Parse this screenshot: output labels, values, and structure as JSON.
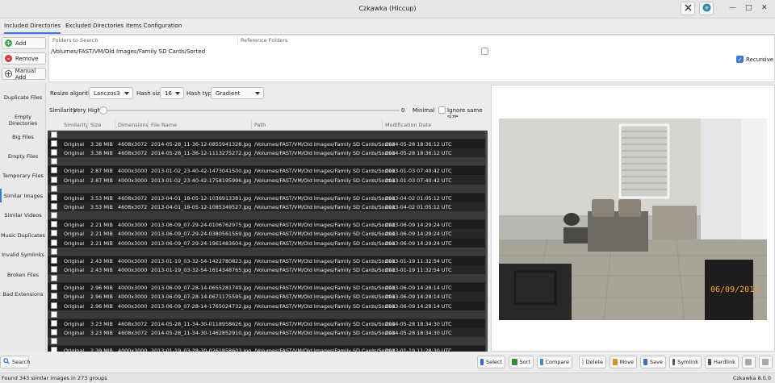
{
  "window": {
    "title": "Czkawka (Hiccup)"
  },
  "top_tabs": [
    "Included Directories",
    "Excluded Directories",
    "Items Configuration"
  ],
  "dir_buttons": {
    "add": "Add",
    "remove": "Remove",
    "manual_add": "Manual Add"
  },
  "dir_table": {
    "col_folders": "Folders to Search",
    "col_reference": "Reference Folders",
    "path": "/Volumes/FAST/VM/Old Images/Family SD Cards/Sorted",
    "recursive_label": "Recursive",
    "recursive_checked": true
  },
  "sidebar": [
    "Duplicate Files",
    "Empty Directories",
    "Big Files",
    "Empty Files",
    "Temporary Files",
    "Similar Images",
    "Similar Videos",
    "Music Duplicates",
    "Invalid Symlinks",
    "Broken Files",
    "Bad Extensions"
  ],
  "sidebar_active": "Similar Images",
  "options": {
    "resize_label": "Resize algorithm",
    "resize_value": "Lanczos3",
    "hash_size_label": "Hash size",
    "hash_size_value": "16",
    "hash_type_label": "Hash type",
    "hash_type_value": "Gradient",
    "similarity_label": "Similarity",
    "similarity_value": "Very High",
    "slider_value": "0",
    "minimal_label": "Minimal",
    "ignore_same_size_label": "Ignore same size"
  },
  "results": {
    "columns": [
      "Similarity",
      "Size",
      "Dimensions",
      "File Name",
      "Path",
      "Modification Date"
    ],
    "rows": [
      {
        "g": true
      },
      {
        "sim": "Original",
        "size": "3.38 MiB",
        "dim": "4608x3072",
        "name": "2014-05-28_11-36-12-0855941328.jpg",
        "path": "/Volumes/FAST/VM/Old Images/Family SD Cards/Sorted",
        "date": "2014-05-28 18:36:12 UTC"
      },
      {
        "sim": "Original",
        "size": "3.38 MiB",
        "dim": "4608x3072",
        "name": "2014-05-28_11-36-12-1113275272.jpg",
        "path": "/Volumes/FAST/VM/Old Images/Family SD Cards/Sorted",
        "date": "2014-05-28 18:36:12 UTC"
      },
      {
        "g": true
      },
      {
        "sim": "Original",
        "size": "2.87 MiB",
        "dim": "4000x3000",
        "name": "2013-01-02_23-40-42-1473041500.jpg",
        "path": "/Volumes/FAST/VM/Old Images/Family SD Cards/Sorted",
        "date": "2013-01-03 07:40:42 UTC"
      },
      {
        "sim": "Original",
        "size": "2.87 MiB",
        "dim": "4000x3000",
        "name": "2013-01-02_23-40-42-1758195996.jpg",
        "path": "/Volumes/FAST/VM/Old Images/Family SD Cards/Sorted",
        "date": "2013-01-03 07:40:42 UTC"
      },
      {
        "g": true
      },
      {
        "sim": "Original",
        "size": "3.53 MiB",
        "dim": "4608x3072",
        "name": "2013-04-01_18-05-12-1036913381.jpg",
        "path": "/Volumes/FAST/VM/Old Images/Family SD Cards/Sorted",
        "date": "2013-04-02 01:05:12 UTC"
      },
      {
        "sim": "Original",
        "size": "3.53 MiB",
        "dim": "4608x3072",
        "name": "2013-04-01_18-05-12-1085349527.jpg",
        "path": "/Volumes/FAST/VM/Old Images/Family SD Cards/Sorted",
        "date": "2013-04-02 01:05:12 UTC"
      },
      {
        "g": true
      },
      {
        "sim": "Original",
        "size": "2.21 MiB",
        "dim": "4000x3000",
        "name": "2013-06-09_07-29-24-0106762975.jpg",
        "path": "/Volumes/FAST/VM/Old Images/Family SD Cards/Sorted",
        "date": "2013-06-09 14:29:24 UTC"
      },
      {
        "sim": "Original",
        "size": "2.21 MiB",
        "dim": "4000x3000",
        "name": "2013-06-09_07-29-24-0380561559.jpg",
        "path": "/Volumes/FAST/VM/Old Images/Family SD Cards/Sorted",
        "date": "2013-06-09 14:29:24 UTC"
      },
      {
        "sim": "Original",
        "size": "2.21 MiB",
        "dim": "4000x3000",
        "name": "2013-06-09_07-29-24-1961483604.jpg",
        "path": "/Volumes/FAST/VM/Old Images/Family SD Cards/Sorted",
        "date": "2013-06-09 14:29:24 UTC"
      },
      {
        "g": true
      },
      {
        "sim": "Original",
        "size": "2.43 MiB",
        "dim": "4000x3000",
        "name": "2013-01-19_03-32-54-1422780823.jpg",
        "path": "/Volumes/FAST/VM/Old Images/Family SD Cards/Sorted",
        "date": "2013-01-19 11:32:54 UTC"
      },
      {
        "sim": "Original",
        "size": "2.43 MiB",
        "dim": "4000x3000",
        "name": "2013-01-19_03-32-54-1614348765.jpg",
        "path": "/Volumes/FAST/VM/Old Images/Family SD Cards/Sorted",
        "date": "2013-01-19 11:32:54 UTC"
      },
      {
        "g": true
      },
      {
        "sim": "Original",
        "size": "2.96 MiB",
        "dim": "4000x3000",
        "name": "2013-06-09_07-28-14-0655281749.jpg",
        "path": "/Volumes/FAST/VM/Old Images/Family SD Cards/Sorted",
        "date": "2013-06-09 14:28:14 UTC"
      },
      {
        "sim": "Original",
        "size": "2.96 MiB",
        "dim": "4000x3000",
        "name": "2013-06-09_07-28-14-0671175595.jpg",
        "path": "/Volumes/FAST/VM/Old Images/Family SD Cards/Sorted",
        "date": "2013-06-09 14:28:14 UTC"
      },
      {
        "sim": "Original",
        "size": "2.96 MiB",
        "dim": "4000x3000",
        "name": "2013-06-09_07-28-14-1765024732.jpg",
        "path": "/Volumes/FAST/VM/Old Images/Family SD Cards/Sorted",
        "date": "2013-06-09 14:28:14 UTC"
      },
      {
        "g": true
      },
      {
        "sim": "Original",
        "size": "3.23 MiB",
        "dim": "4608x3072",
        "name": "2014-05-28_11-34-30-0118958626.jpg",
        "path": "/Volumes/FAST/VM/Old Images/Family SD Cards/Sorted",
        "date": "2014-05-28 18:34:30 UTC"
      },
      {
        "sim": "Original",
        "size": "3.23 MiB",
        "dim": "4608x3072",
        "name": "2014-05-28_11-34-30-1462852910.jpg",
        "path": "/Volumes/FAST/VM/Old Images/Family SD Cards/Sorted",
        "date": "2014-05-28 18:34:30 UTC"
      },
      {
        "g": true
      },
      {
        "sim": "Original",
        "size": "2.39 MiB",
        "dim": "4000x3000",
        "name": "2013-01-19_03-28-30-0261858603.jpg",
        "path": "/Volumes/FAST/VM/Old Images/Family SD Cards/Sorted",
        "date": "2013-01-19 11:28:30 UTC"
      }
    ]
  },
  "preview": {
    "date_stamp": "06/09/2013"
  },
  "bottom": {
    "search": "Search",
    "select": "Select",
    "sort": "Sort",
    "compare": "Compare",
    "delete": "Delete",
    "move": "Move",
    "save": "Save",
    "symlink": "Symlink",
    "hardlink": "Hardlink"
  },
  "status": {
    "left": "Found 343 similar images in 273 groups",
    "right": "Czkawka 8.0.0"
  },
  "colors": {
    "accent": "#3a7bd5",
    "add_green": "#3aa844",
    "remove_red": "#d83a3a"
  }
}
